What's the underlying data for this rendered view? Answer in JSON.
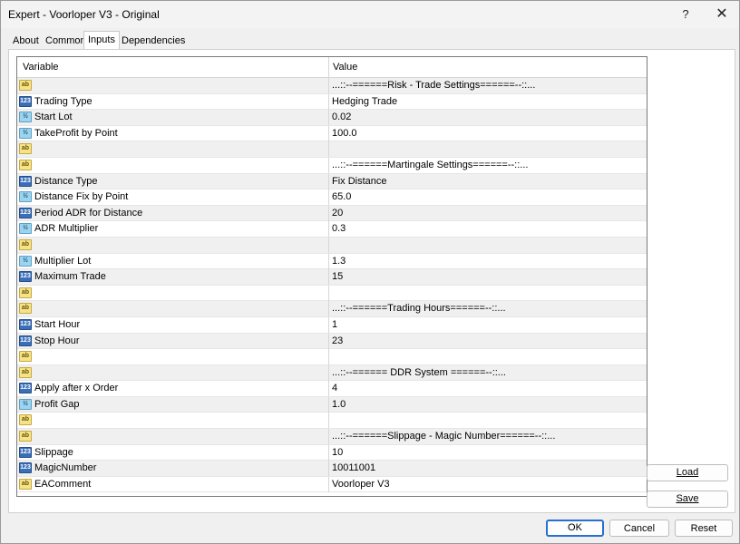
{
  "window": {
    "title": "Expert - Voorloper V3 - Original",
    "help_glyph": "?",
    "close_glyph": "✕"
  },
  "tabs": [
    "About",
    "Common",
    "Inputs",
    "Dependencies"
  ],
  "active_tab": "Inputs",
  "grid": {
    "columns": {
      "variable": "Variable",
      "value": "Value"
    },
    "rows": [
      {
        "type": "ab",
        "icon_text": "ab",
        "name": "",
        "value": "...::--======Risk - Trade Settings======--::..."
      },
      {
        "type": "num",
        "icon_text": "123",
        "name": "Trading Type",
        "value": "Hedging Trade"
      },
      {
        "type": "dbl",
        "icon_text": "½",
        "name": "Start Lot",
        "value": "0.02"
      },
      {
        "type": "dbl",
        "icon_text": "½",
        "name": "TakeProfit by Point",
        "value": "100.0"
      },
      {
        "type": "ab",
        "icon_text": "ab",
        "name": "",
        "value": ""
      },
      {
        "type": "ab",
        "icon_text": "ab",
        "name": "",
        "value": "...::--======Martingale Settings======--::..."
      },
      {
        "type": "num",
        "icon_text": "123",
        "name": "Distance Type",
        "value": "Fix Distance"
      },
      {
        "type": "dbl",
        "icon_text": "½",
        "name": "Distance Fix by Point",
        "value": "65.0"
      },
      {
        "type": "num",
        "icon_text": "123",
        "name": "Period ADR for Distance",
        "value": "20"
      },
      {
        "type": "dbl",
        "icon_text": "½",
        "name": "ADR Multiplier",
        "value": "0.3"
      },
      {
        "type": "ab",
        "icon_text": "ab",
        "name": "",
        "value": ""
      },
      {
        "type": "dbl",
        "icon_text": "½",
        "name": "Multiplier Lot",
        "value": "1.3"
      },
      {
        "type": "num",
        "icon_text": "123",
        "name": "Maximum Trade",
        "value": "15"
      },
      {
        "type": "ab",
        "icon_text": "ab",
        "name": "",
        "value": ""
      },
      {
        "type": "ab",
        "icon_text": "ab",
        "name": "",
        "value": "...::--======Trading Hours======--::..."
      },
      {
        "type": "num",
        "icon_text": "123",
        "name": "Start Hour",
        "value": "1"
      },
      {
        "type": "num",
        "icon_text": "123",
        "name": "Stop Hour",
        "value": "23"
      },
      {
        "type": "ab",
        "icon_text": "ab",
        "name": "",
        "value": ""
      },
      {
        "type": "ab",
        "icon_text": "ab",
        "name": "",
        "value": "...::--====== DDR System ======--::..."
      },
      {
        "type": "num",
        "icon_text": "123",
        "name": "Apply after x Order",
        "value": "4"
      },
      {
        "type": "dbl",
        "icon_text": "½",
        "name": "Profit Gap",
        "value": "1.0"
      },
      {
        "type": "ab",
        "icon_text": "ab",
        "name": "",
        "value": ""
      },
      {
        "type": "ab",
        "icon_text": "ab",
        "name": "",
        "value": "...::--======Slippage - Magic Number======--::..."
      },
      {
        "type": "num",
        "icon_text": "123",
        "name": "Slippage",
        "value": "10"
      },
      {
        "type": "num",
        "icon_text": "123",
        "name": "MagicNumber",
        "value": "10011001"
      },
      {
        "type": "ab",
        "icon_text": "ab",
        "name": "EAComment",
        "value": "Voorloper V3"
      }
    ]
  },
  "side_buttons": {
    "load": "Load",
    "save": "Save"
  },
  "footer": {
    "ok": "OK",
    "cancel": "Cancel",
    "reset": "Reset"
  }
}
